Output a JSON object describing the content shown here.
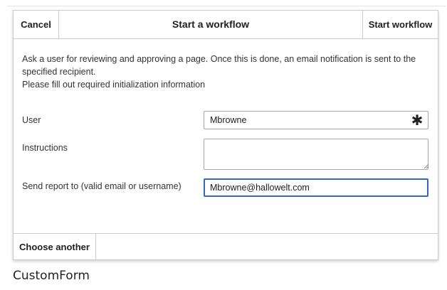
{
  "dialog": {
    "title": "Start a workflow",
    "cancel_label": "Cancel",
    "start_label": "Start workflow",
    "description_line1": "Ask a user for reviewing and approving a page. Once this is done, an email notification is sent to the specified recipient.",
    "description_line2": "Please fill out required initialization information",
    "fields": {
      "user": {
        "label": "User",
        "value": "Mbrowne",
        "required_symbol": "✱"
      },
      "instructions": {
        "label": "Instructions",
        "value": ""
      },
      "report": {
        "label": "Send report to (valid email or username)",
        "value": "Mbrowne@hallowelt.com"
      }
    },
    "choose_another_label": "Choose another"
  },
  "caption": "CustomForm",
  "colors": {
    "border": "#c8ccd1",
    "focus": "#3366cc",
    "text": "#202122"
  }
}
